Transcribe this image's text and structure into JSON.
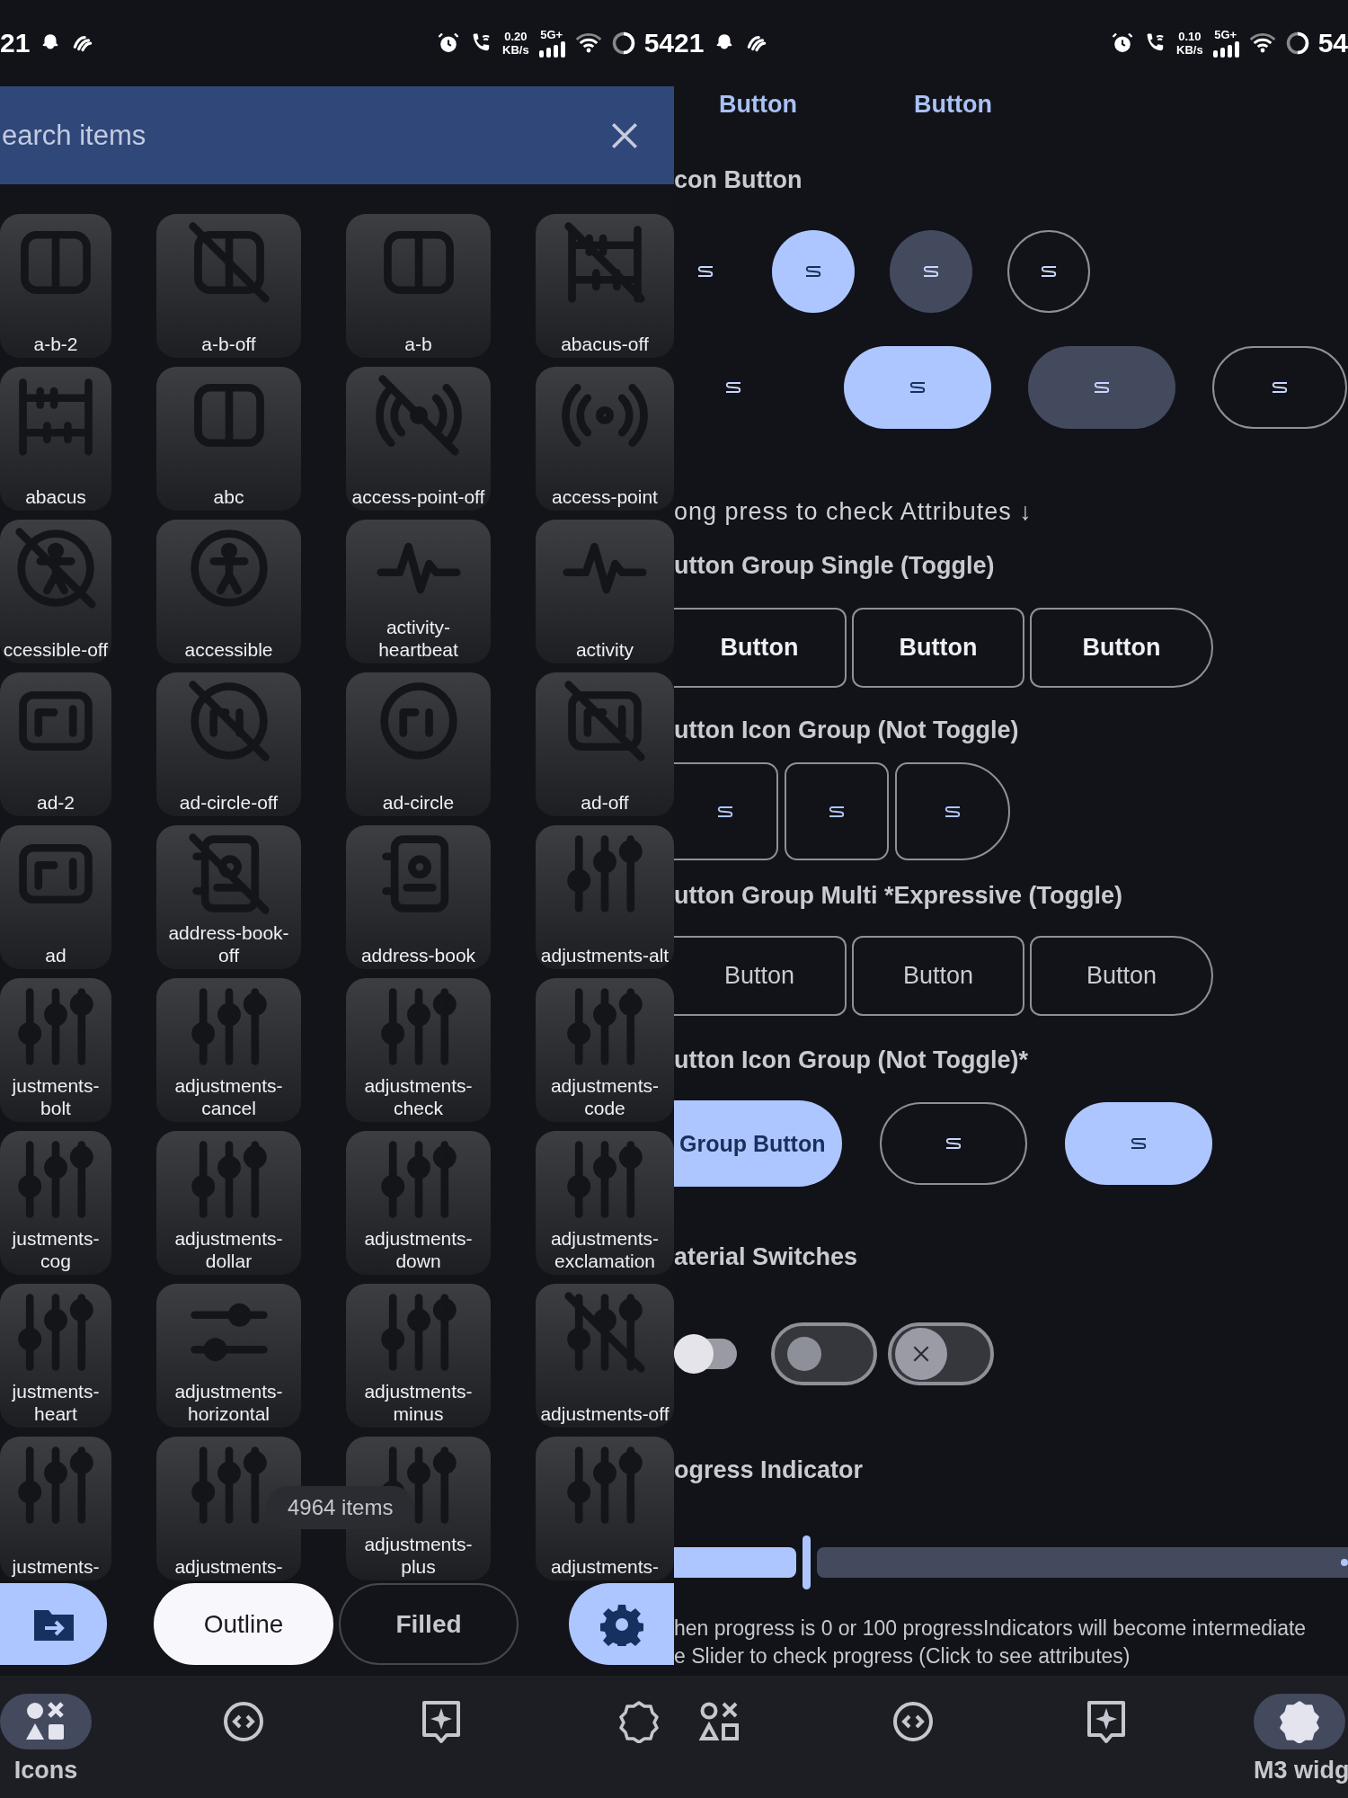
{
  "left_screen": {
    "status_bar": {
      "time": "21",
      "net_speed": "0.20",
      "net_unit": "KB/s",
      "network": "5G+",
      "battery": "54"
    },
    "search": {
      "placeholder": "earch items"
    },
    "icon_tiles": [
      {
        "label": "a-b-2"
      },
      {
        "label": "a-b-off"
      },
      {
        "label": "a-b"
      },
      {
        "label": "abacus-off"
      },
      {
        "label": "abacus"
      },
      {
        "label": "abc"
      },
      {
        "label": "access-point-off"
      },
      {
        "label": "access-point"
      },
      {
        "label": "ccessible-off"
      },
      {
        "label": "accessible"
      },
      {
        "label": "activity-heartbeat"
      },
      {
        "label": "activity"
      },
      {
        "label": "ad-2"
      },
      {
        "label": "ad-circle-off"
      },
      {
        "label": "ad-circle"
      },
      {
        "label": "ad-off"
      },
      {
        "label": "ad"
      },
      {
        "label": "address-book-off"
      },
      {
        "label": "address-book"
      },
      {
        "label": "adjustments-alt"
      },
      {
        "label": "justments-bolt"
      },
      {
        "label": "adjustments-cancel"
      },
      {
        "label": "adjustments-check"
      },
      {
        "label": "adjustments-code"
      },
      {
        "label": "justments-cog"
      },
      {
        "label": "adjustments-dollar"
      },
      {
        "label": "adjustments-down"
      },
      {
        "label": "adjustments-exclamation"
      },
      {
        "label": "justments-heart"
      },
      {
        "label": "adjustments-horizontal"
      },
      {
        "label": "adjustments-minus"
      },
      {
        "label": "adjustments-off"
      },
      {
        "label": "justments-"
      },
      {
        "label": "adjustments-"
      },
      {
        "label": "adjustments-plus"
      },
      {
        "label": "adjustments-"
      }
    ],
    "item_count": "4964 items",
    "style_toggle": [
      {
        "label": "Outline",
        "selected": true
      },
      {
        "label": "Filled",
        "selected": false
      }
    ],
    "nav": [
      {
        "label": "Icons",
        "selected": true
      },
      {
        "selected": false
      },
      {
        "selected": false
      },
      {
        "selected": false
      }
    ]
  },
  "right_screen": {
    "status_bar": {
      "time": "21",
      "net_speed": "0.10",
      "net_unit": "KB/s",
      "network": "5G+",
      "battery": "54"
    },
    "top_buttons": [
      "Button",
      "Button"
    ],
    "icon_button": {
      "heading": "con Button",
      "round": [
        {
          "kind": "standard"
        },
        {
          "kind": "filled"
        },
        {
          "kind": "tonal"
        },
        {
          "kind": "outlined"
        }
      ],
      "wide": [
        {
          "kind": "standard"
        },
        {
          "kind": "filled"
        },
        {
          "kind": "tonal"
        },
        {
          "kind": "outlined"
        }
      ]
    },
    "hint": "ong press to check Attributes ↓",
    "group_single": {
      "heading": "utton Group Single (Toggle)",
      "buttons": [
        {
          "label": "Button",
          "selected": false
        },
        {
          "label": "Button",
          "selected": false
        },
        {
          "label": "Button",
          "selected": false
        }
      ]
    },
    "icon_group": {
      "heading": "utton Icon Group (Not Toggle)",
      "buttons": [
        {
          "selected": false
        },
        {
          "selected": false
        },
        {
          "selected": false
        }
      ]
    },
    "group_multi": {
      "heading": "utton Group Multi *Expressive (Toggle)",
      "buttons": [
        {
          "label": "Button",
          "selected": false
        },
        {
          "label": "Button",
          "selected": false
        },
        {
          "label": "Button",
          "selected": false
        }
      ]
    },
    "icon_group_expressive": {
      "heading": "utton Icon Group (Not Toggle)*",
      "buttons": [
        {
          "kind": "filled",
          "label": "Group Button"
        },
        {
          "kind": "outlined"
        },
        {
          "kind": "filled"
        }
      ]
    },
    "switches": {
      "heading": "aterial Switches",
      "items": [
        {
          "kind": "compact",
          "checked": false
        },
        {
          "kind": "outlined",
          "checked": false
        },
        {
          "kind": "icon",
          "checked": false
        }
      ]
    },
    "progress": {
      "heading": "ogress Indicator",
      "level": 0.2,
      "note": [
        "hen progress is 0 or 100 progressIndicators will become intermediate",
        "e Slider to check progress (Click to see attributes)"
      ]
    },
    "nav": [
      {
        "selected": false
      },
      {
        "selected": false
      },
      {
        "selected": false
      },
      {
        "label": "M3 widg",
        "selected": true
      }
    ]
  }
}
